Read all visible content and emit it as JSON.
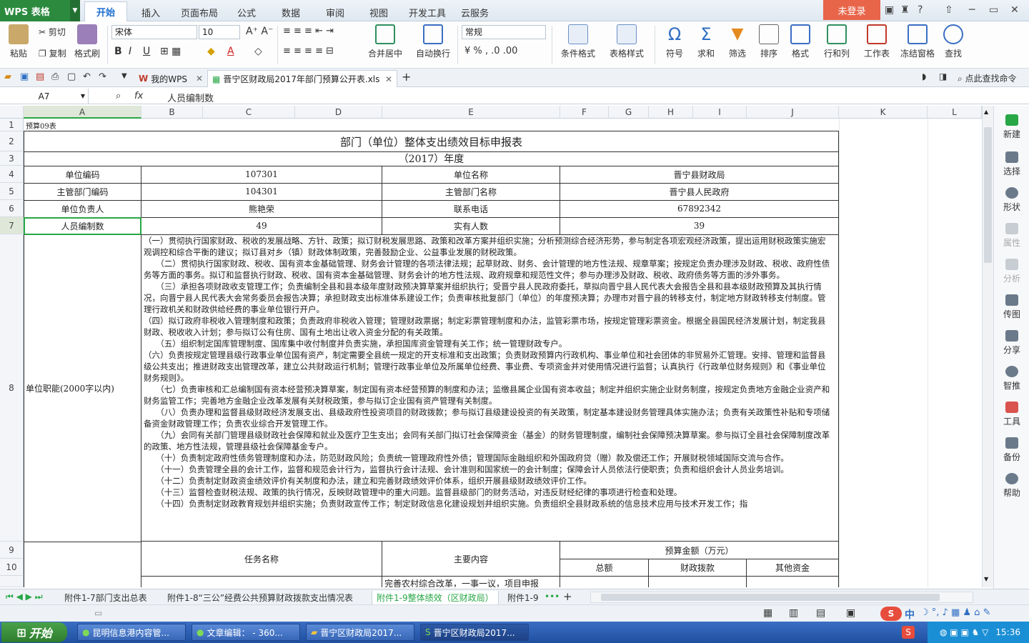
{
  "app": {
    "logo": "WPS 表格",
    "login": "未登录"
  },
  "menu": [
    "开始",
    "插入",
    "页面布局",
    "公式",
    "数据",
    "审阅",
    "视图",
    "开发工具",
    "云服务"
  ],
  "ribbon": {
    "paste": "粘贴",
    "cut": "剪切",
    "copy": "复制",
    "format_painter": "格式刷",
    "font": "宋体",
    "size": "10",
    "number_format": "常规",
    "merge": "合并居中",
    "wrap": "自动换行",
    "big": [
      "条件格式",
      "表格样式",
      "符号",
      "求和",
      "筛选",
      "排序",
      "格式",
      "行和列",
      "工作表",
      "冻结窗格",
      "查找"
    ]
  },
  "docbar": {
    "mywps": "我的WPS",
    "file": "晋宁区财政局2017年部门预算公开表.xls",
    "search": "点此查找命令"
  },
  "formula": {
    "namebox": "A7",
    "fx": "fx",
    "value": "人员编制数"
  },
  "columns": [
    "A",
    "B",
    "C",
    "D",
    "E",
    "F",
    "G",
    "H",
    "I",
    "J",
    "K",
    "L"
  ],
  "rows": [
    "1",
    "2",
    "3",
    "4",
    "5",
    "6",
    "7",
    "8",
    "9",
    "10"
  ],
  "sheet": {
    "a1": "预算09表",
    "title": "部门（单位）整体支出绩效目标申报表",
    "year": "（2017）年度",
    "r4": [
      "单位编码",
      "107301",
      "单位名称",
      "晋宁县财政局"
    ],
    "r5": [
      "主管部门编码",
      "104301",
      "主管部门名称",
      "晋宁县人民政府"
    ],
    "r6": [
      "单位负责人",
      "熊艳荣",
      "联系电话",
      "67892342"
    ],
    "r7": [
      "人员编制数",
      "49",
      "实有人数",
      "39"
    ],
    "duty_label": "单位职能(2000字以内)",
    "duties": [
      "（一）贯彻执行国家财政、税收的发展战略、方针、政策；拟订财税发展思路、政策和改革方案并组织实施；分析预测综合经济形势，参与制定各项宏观经济政策，提出运用财税政策实施宏观调控和综合平衡的建议；拟订县对乡（镇）财政体制政策，完善鼓励企业、公益事业发展的财税政策。",
      "　　（二）贯彻执行国家财政、税收、国有资本金基础管理、财务会计管理的各项法律法规；起草财政、财务、会计管理的地方性法规、规章草案；按规定负责办理涉及财政、税收、政府性债务等方面的事务。拟订和监督执行财政、税收、国有资本金基础管理、财务会计的地方性法规、政府规章和规范性文件；参与办理涉及财政、税收、政府债务等方面的涉外事务。",
      "　　（三）承担各项财政收支管理工作；负责编制全县和县本级年度财政预决算草案并组织执行；受晋宁县人民政府委托，草拟向晋宁县人民代表大会报告全县和县本级财政预算及其执行情况，向晋宁县人民代表大会常务委员会报告决算；承担财政支出标准体系建设工作；负责审核批复部门（单位）的年度预决算；办理市对晋宁县的转移支付，制定地方财政转移支付制度。管理行政机关和财政供给经费的事业单位银行开户。",
      "（四）拟订政府非税收入管理制度和政策；负责政府非税收入管理；管理财政票据；制定彩票管理制度和办法，监管彩票市场，按规定管理彩票资金。根据全县国民经济发展计划，制定我县财政、税收收入计划；参与拟订公有住房、国有土地出让收入资金分配的有关政策。",
      "　　（五）组织制定国库管理制度、国库集中收付制度并负责实施，承担国库资金管理有关工作；统一管理财政专户。",
      "（六）负责按规定管理县级行政事业单位国有资产，制定需要全县统一规定的开支标准和支出政策；负责财政预算内行政机构、事业单位和社会团体的非贸易外汇管理。安排、管理和监督县级公共支出；推进财政支出管理改革，建立公共财政运行机制；管理行政事业单位及所属单位经费、事业费、专项资金并对使用情况进行监督；认真执行《行政单位财务规则》和《事业单位财务规则》。",
      "　　（七）负责审核和汇总编制国有资本经营预决算草案，制定国有资本经营预算的制度和办法；监缴县属企业国有资本收益；制定并组织实施企业财务制度，按规定负责地方金融企业资产和财务监管工作；完善地方金融企业改革发展有关财税政策，参与拟订企业国有资产管理有关制度。",
      "　　（八）负责办理和监督县级财政经济发展支出、县级政府性投资项目的财政拨款；参与拟订县级建设投资的有关政策，制定基本建设财务管理具体实施办法；负责有关政策性补贴和专项储备资金财政管理工作；负责农业综合开发管理工作。",
      "　　（九）会同有关部门管理县级财政社会保障和就业及医疗卫生支出；会同有关部门拟订社会保障资金（基金）的财务管理制度，编制社会保障预决算草案。参与拟订全县社会保障制度改革的政策、地方性法规，管理县级社会保障基金专户。",
      "　　（十）负责制定政府性债务管理制度和办法，防范财政风险；负责统一管理政府性外债；管理国际金融组织和外国政府贷（赠）款及偿还工作；开展财税领域国际交流与合作。",
      "　　（十一）负责管理全县的会计工作，监督和规范会计行为，监督执行会计法规、会计准则和国家统一的会计制度；保障会计人员依法行使职责；负责和组织会计人员业务培训。",
      "　　（十二）负责制定财政资金绩效评价有关制度和办法，建立和完善财政绩效评价体系，组织开展县级财政绩效评价工作。",
      "　　（十三）监督检查财税法规、政策的执行情况，反映财政管理中的重大问题。监督县级部门的财务活动，对违反财经纪律的事项进行检查和处理。",
      "　　（十四）负责制定财政教育规划并组织实施；负责财政宣传工作；制定财政信息化建设规划并组织实施。负责组织全县财政系统的信息技术应用与技术开发工作；指"
    ],
    "task_name": "任务名称",
    "main_content": "主要内容",
    "budget": "预算金额（万元）",
    "total": "总额",
    "fiscal": "财政拨款",
    "other": "其他资金",
    "r11_partial": "完善农村综合改革，一事一议，项目申报"
  },
  "sidebar": [
    "新建",
    "选择",
    "形状",
    "属性",
    "分析",
    "传图",
    "分享",
    "智推",
    "工具",
    "备份",
    "帮助"
  ],
  "sheets": [
    "附件1-7部门支出总表",
    "附件1-8“三公”经费公共预算财政拨款支出情况表",
    "附件1-9整体绩效（区财政局）",
    "附件1-9"
  ],
  "taskbar": {
    "start": "开始",
    "items": [
      "昆明信息港内容管...",
      "文章编辑： - 360...",
      "晋宁区财政局2017...",
      "晋宁区财政局2017..."
    ],
    "time": "15:36"
  },
  "ime": "中"
}
